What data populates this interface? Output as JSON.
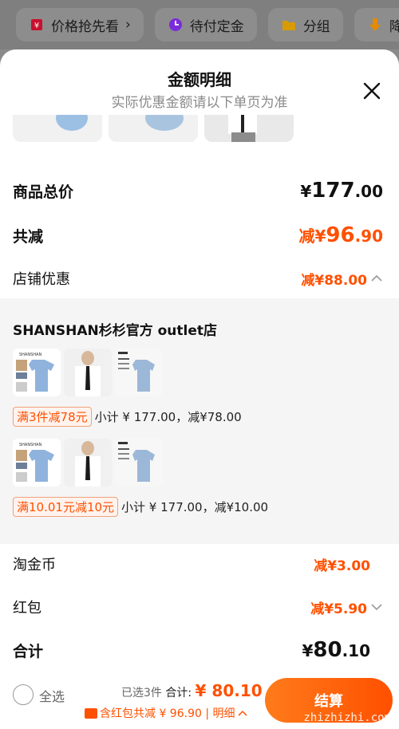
{
  "topbar": {
    "items": [
      {
        "label": "价格抢先看",
        "icon": "price-tag-icon",
        "color": "#c8102e"
      },
      {
        "label": "待付定金",
        "icon": "clock-icon",
        "color": "#7b2cd9"
      },
      {
        "label": "分组",
        "icon": "folder-icon",
        "color": "#d79b00"
      },
      {
        "label": "降",
        "icon": "down-arrow-icon",
        "color": "#e68a00"
      }
    ]
  },
  "sheet": {
    "title": "金额明细",
    "subtitle": "实际优惠金额请以下单页为准"
  },
  "summary": {
    "total_label": "商品总价",
    "total": {
      "cur": "¥",
      "int": "177",
      "dec": ".00"
    },
    "reduce_label": "共减",
    "reduce": {
      "prefix": "减",
      "cur": "¥",
      "int": "96",
      "dec": ".90"
    },
    "shop_discount_label": "店铺优惠",
    "shop_discount": "减¥88.00"
  },
  "shop": {
    "name": "SHANSHAN杉杉官方 outlet店",
    "groups": [
      {
        "tag": "满3件减78元",
        "text": "小计 ¥ 177.00，减¥78.00"
      },
      {
        "tag": "满10.01元减10元",
        "text": "小计 ¥ 177.00，减¥10.00"
      }
    ],
    "brand_text": "SHANSHAN"
  },
  "others": {
    "coin_label": "淘金币",
    "coin": "减¥3.00",
    "redpack_label": "红包",
    "redpack": "减¥5.90",
    "sum_label": "合计",
    "sum": {
      "cur": "¥",
      "int": "80",
      "dec": ".10"
    }
  },
  "bottom": {
    "select_all": "全选",
    "selected": "已选3件",
    "total_prefix": "合计:",
    "total": "¥ 80.10",
    "detail": "含红包共减 ¥ 96.90 | 明细",
    "settle": "结算",
    "watermark": "zhizhizhi.com"
  },
  "colors": {
    "accent": "#ff5000",
    "background": "#ffffff"
  }
}
